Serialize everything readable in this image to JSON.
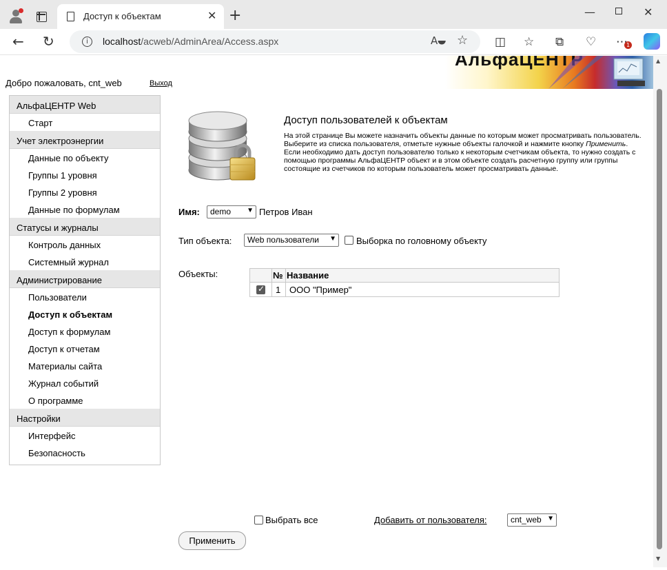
{
  "browser": {
    "tab_title": "Доступ к объектам",
    "url_host": "localhost",
    "url_path": "/acweb/AdminArea/Access.aspx",
    "tab_close": "✕",
    "new_tab": "+",
    "icons": [
      "profile-icon",
      "tabs-icon",
      "page-icon",
      "back-icon",
      "reload-icon",
      "info-icon",
      "read-aloud-icon",
      "favorite-icon",
      "split-screen-icon",
      "favorites-icon",
      "collections-icon",
      "health-icon",
      "more-icon",
      "copilot-icon"
    ],
    "badge_count": "1"
  },
  "header": {
    "brand": "АльфаЦЕНТР",
    "welcome": "Добро пожаловать, cnt_web",
    "logout": "Выход"
  },
  "menu": {
    "sections": [
      {
        "label": "АльфаЦЕНТР Web",
        "items": [
          "Старт"
        ]
      },
      {
        "label": "Учет электроэнергии",
        "items": [
          "Данные по объекту",
          "Группы 1 уровня",
          "Группы 2 уровня",
          "Данные по формулам"
        ]
      },
      {
        "label": "Статусы и журналы",
        "items": [
          "Контроль данных",
          "Системный журнал"
        ]
      },
      {
        "label": "Администрирование",
        "items": [
          "Пользователи",
          "Доступ к объектам",
          "Доступ к формулам",
          "Доступ к отчетам",
          "Материалы сайта",
          "Журнал событий",
          "О программе"
        ]
      },
      {
        "label": "Настройки",
        "items": [
          "Интерфейс",
          "Безопасность"
        ]
      }
    ],
    "active_item": "Доступ к объектам"
  },
  "content": {
    "title": "Доступ пользователей к объектам",
    "desc_part1": "На этой странице Вы можете назначить объекты данные по которым может просматривать пользователь. Выберите из списка пользователя, отметьте нужные объекты галочкой и нажмите кнопку ",
    "desc_italic": "Применить",
    "desc_part2": ". Если необходимо дать доступ пользователю только к некоторым счетчикам объекта, то нужно создать с помощью программы АльфаЦЕНТР объект и в этом объекте создать расчетную группу или группы состоящие из счетчиков по которым пользователь может просматривать данные.",
    "name_label": "Имя:",
    "name_value": "demo",
    "name_fullname": "Петров Иван",
    "type_label": "Тип объекта:",
    "type_value": "Web пользователи",
    "head_object_label": "Выборка по головному объекту",
    "head_object_checked": false,
    "objects_label": "Объекты:",
    "table": {
      "headers": [
        "",
        "№",
        "Название"
      ],
      "rows": [
        {
          "checked": true,
          "num": "1",
          "name": "ООО \"Пример\""
        }
      ]
    },
    "select_all_label": "Выбрать все",
    "add_from_user_label": "Добавить от пользователя:",
    "add_from_user_value": "cnt_web",
    "apply_button": "Применить"
  }
}
